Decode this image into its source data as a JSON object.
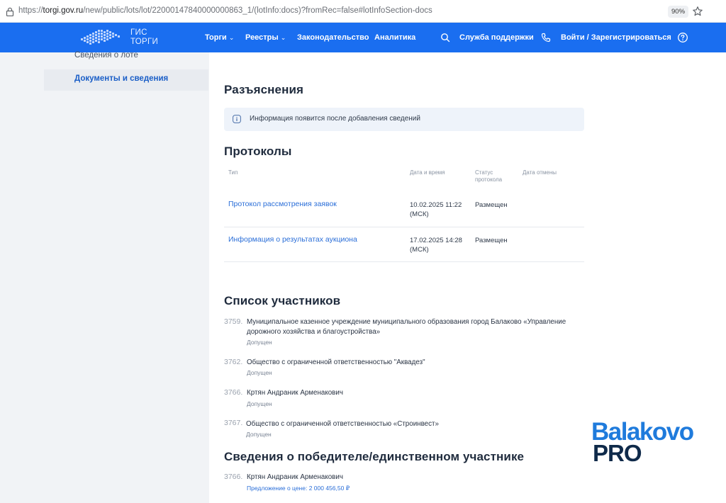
{
  "browser": {
    "url_prefix": "https://",
    "url_host": "torgi.gov.ru",
    "url_path": "/new/public/lots/lot/22000147840000000863_1/(lotInfo:docs)?fromRec=false#lotInfoSection-docs",
    "zoom": "90%"
  },
  "header": {
    "logo_line1": "ГИС",
    "logo_line2": "ТОРГИ",
    "nav": {
      "torgi": "Торги",
      "reestry": "Реестры",
      "zakon": "Законодательство",
      "analytics": "Аналитика"
    },
    "support": "Служба поддержки",
    "login": "Войти / Зарегистрироваться",
    "colors": {
      "bar": "#1a6ef0"
    }
  },
  "sidebar": {
    "items": [
      {
        "label": "Сведения о лоте"
      },
      {
        "label": "Документы и сведения"
      }
    ]
  },
  "explanations": {
    "title": "Разъяснения",
    "info": "Информация появится после добавления сведений"
  },
  "protocols": {
    "title": "Протоколы",
    "columns": {
      "type": "Тип",
      "datetime": "Дата и время",
      "status_l1": "Статус",
      "status_l2": "протокола",
      "cancel": "Дата отмены"
    },
    "rows": [
      {
        "name": "Протокол рассмотрения заявок",
        "date": "10.02.2025 11:22",
        "tz": "(МСК)",
        "status": "Размещен"
      },
      {
        "name": "Информация о результатах аукциона",
        "date": "17.02.2025 14:28",
        "tz": "(МСК)",
        "status": "Размещен"
      }
    ]
  },
  "participants": {
    "title": "Список участников",
    "items": [
      {
        "num": "3759.",
        "name": "Муниципальное казенное учреждение муниципального образования город Балаково «Управление дорожного хозяйства и благоустройства»",
        "status": "Допущен"
      },
      {
        "num": "3762.",
        "name": "Общество с ограниченной ответственностью \"Аквадез\"",
        "status": "Допущен"
      },
      {
        "num": "3766.",
        "name": "Кртян Андраник Арменакович",
        "status": "Допущен"
      },
      {
        "num": "3767.",
        "name": "Общество с ограниченной ответственностью «Строинвест»",
        "status": "Допущен"
      }
    ]
  },
  "winner": {
    "title": "Сведения о победителе/единственном участнике",
    "num": "3766.",
    "name": "Кртян Андраник Арменакович",
    "offer": "Предложение о цене: 2 000 456,50 ₽"
  },
  "watermark": {
    "line1": "Balakovo",
    "line2": "PRO"
  }
}
